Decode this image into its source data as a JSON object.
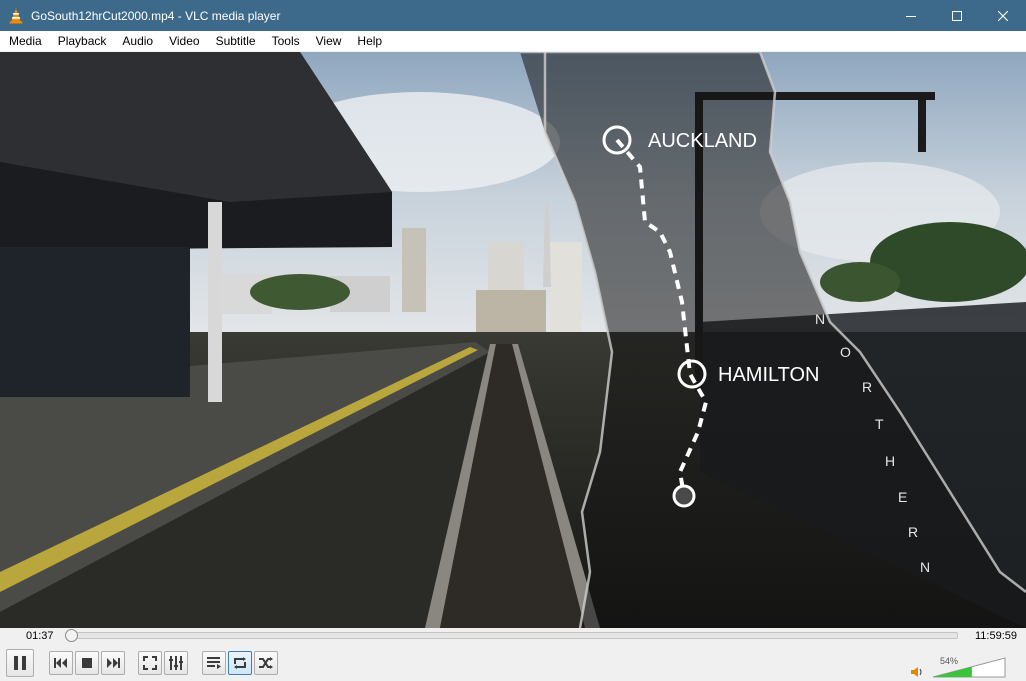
{
  "window": {
    "title": "GoSouth12hrCut2000.mp4 - VLC media player",
    "accent_color": "#3d6a8a"
  },
  "menu": {
    "items": [
      "Media",
      "Playback",
      "Audio",
      "Video",
      "Subtitle",
      "Tools",
      "View",
      "Help"
    ]
  },
  "video": {
    "overlay_labels": {
      "auckland": "AUCKLAND",
      "hamilton": "HAMILTON",
      "northern": [
        "N",
        "O",
        "R",
        "T",
        "H",
        "E",
        "R",
        "N"
      ]
    }
  },
  "playback": {
    "elapsed": "01:37",
    "total": "11:59:59",
    "progress_fraction": 0.002
  },
  "controls": {
    "buttons": [
      {
        "name": "pause-button",
        "icon": "pause-icon"
      },
      {
        "name": "previous-button",
        "icon": "skip-back-icon"
      },
      {
        "name": "stop-button",
        "icon": "stop-icon"
      },
      {
        "name": "next-button",
        "icon": "skip-forward-icon"
      },
      {
        "name": "fullscreen-button",
        "icon": "fullscreen-icon"
      },
      {
        "name": "extended-settings-button",
        "icon": "equalizer-icon"
      },
      {
        "name": "playlist-button",
        "icon": "playlist-icon"
      },
      {
        "name": "loop-button",
        "icon": "loop-icon",
        "active": true
      },
      {
        "name": "random-button",
        "icon": "shuffle-icon"
      }
    ]
  },
  "volume": {
    "percent_label": "54%",
    "level": 0.54,
    "fill_color": "#3cc33c"
  }
}
